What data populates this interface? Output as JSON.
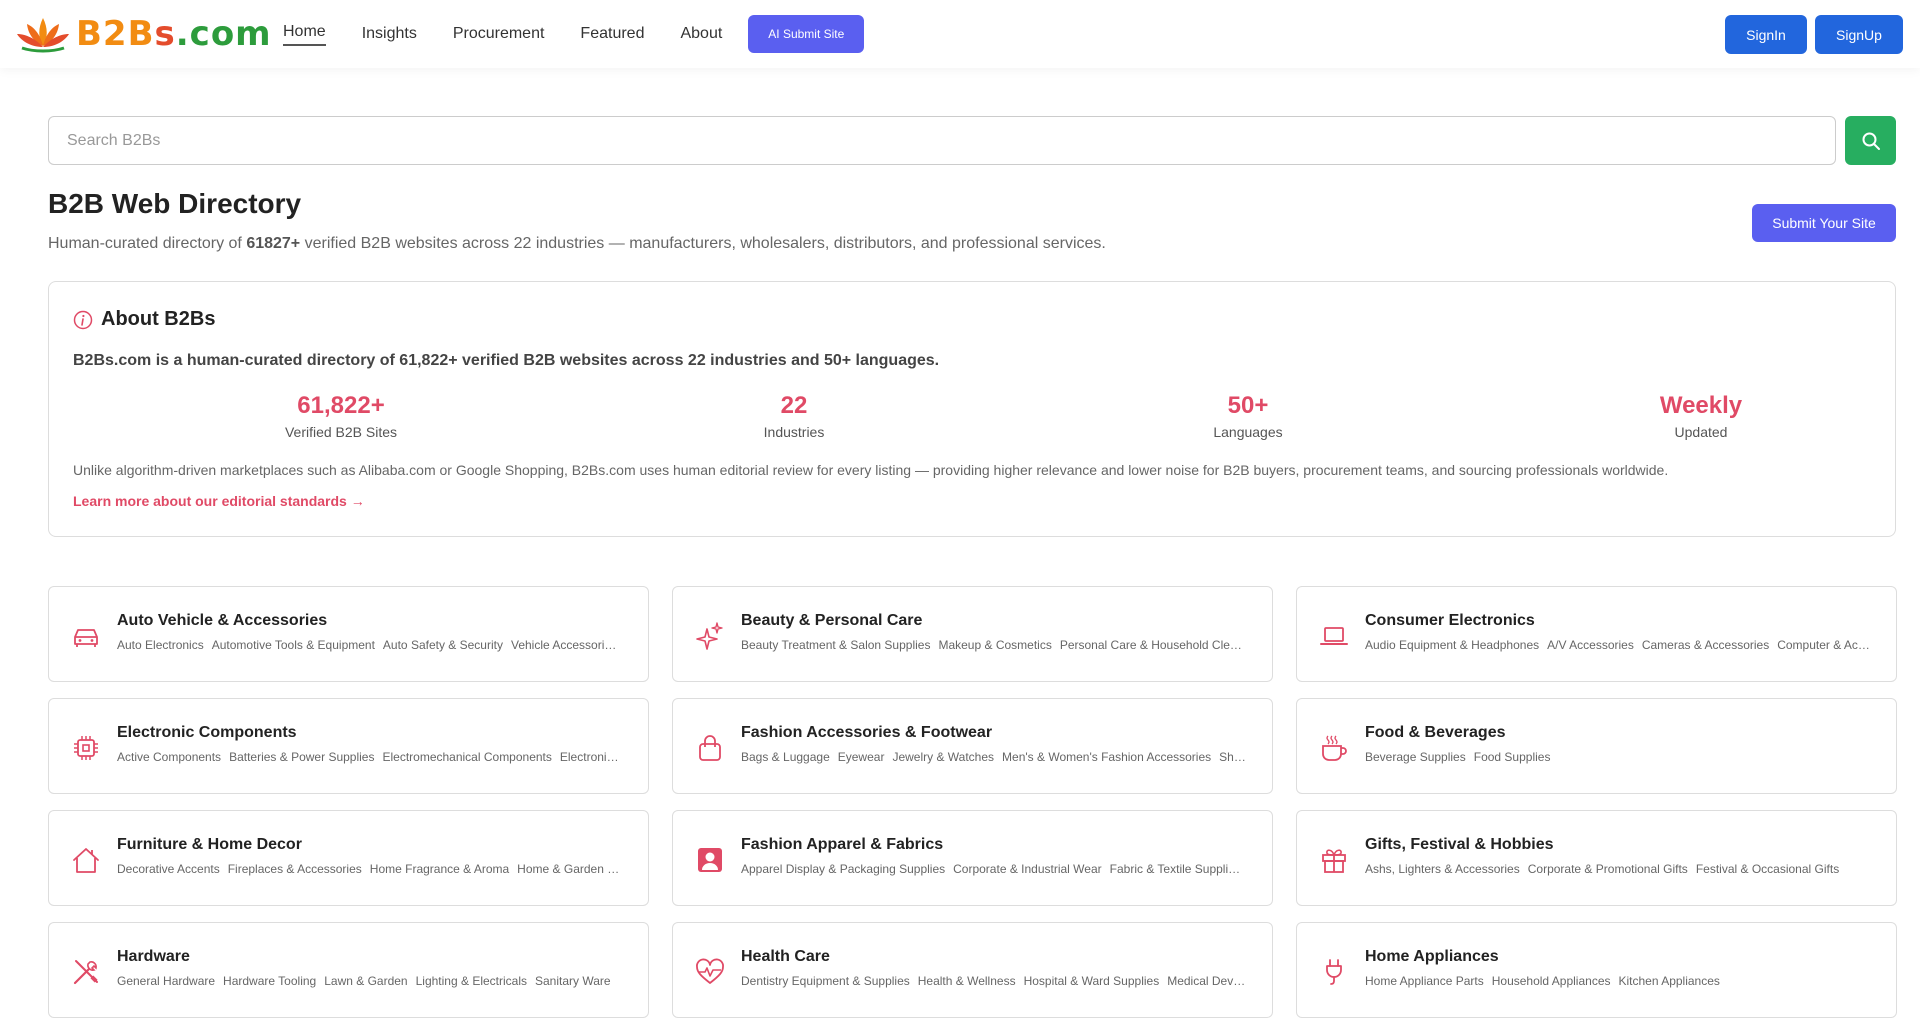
{
  "logo": {
    "b2b": "B2B",
    "s": "s",
    "com": ".com"
  },
  "nav": [
    {
      "label": "Home",
      "active": true
    },
    {
      "label": "Insights"
    },
    {
      "label": "Procurement"
    },
    {
      "label": "Featured"
    },
    {
      "label": "About"
    }
  ],
  "ai_submit": "AI Submit Site",
  "auth": {
    "signin": "SignIn",
    "signup": "SignUp"
  },
  "search": {
    "placeholder": "Search B2Bs"
  },
  "title": "B2B Web Directory",
  "subtitle": {
    "pre": "Human-curated directory of ",
    "count": "61827+",
    "post": " verified B2B websites across 22 industries — manufacturers, wholesalers, distributors, and professional services."
  },
  "submit_button": "Submit Your Site",
  "about": {
    "heading": "About B2Bs",
    "lead": "B2Bs.com is a human-curated directory of 61,822+ verified B2B websites across 22 industries and 50+ languages.",
    "stats": [
      {
        "value": "61,822+",
        "label": "Verified B2B Sites"
      },
      {
        "value": "22",
        "label": "Industries"
      },
      {
        "value": "50+",
        "label": "Languages"
      },
      {
        "value": "Weekly",
        "label": "Updated"
      }
    ],
    "body": "Unlike algorithm-driven marketplaces such as Alibaba.com or Google Shopping, B2Bs.com uses human editorial review for every listing — providing higher relevance and lower noise for B2B buyers, procurement teams, and sourcing professionals worldwide.",
    "link": "Learn more about our editorial standards →"
  },
  "colors": {
    "accent": "#e04a66",
    "primary": "#5a5ff0",
    "auth": "#2266dd",
    "search": "#27ae60"
  },
  "categories": [
    {
      "title": "Auto Vehicle & Accessories",
      "icon": "car-icon",
      "subs": [
        "Auto Electronics",
        "Automotive Tools & Equipment",
        "Auto Safety & Security",
        "Vehicle Accessories"
      ]
    },
    {
      "title": "Beauty & Personal Care",
      "icon": "sparkles-icon",
      "subs": [
        "Beauty Treatment & Salon Supplies",
        "Makeup & Cosmetics",
        "Personal Care & Household Cleaning"
      ]
    },
    {
      "title": "Consumer Electronics",
      "icon": "laptop-icon",
      "subs": [
        "Audio Equipment & Headphones",
        "A/V Accessories",
        "Cameras & Accessories",
        "Computer & Accessories"
      ]
    },
    {
      "title": "Electronic Components",
      "icon": "chip-icon",
      "subs": [
        "Active Components",
        "Batteries & Power Supplies",
        "Electromechanical Components",
        "Electronic Accessories"
      ]
    },
    {
      "title": "Fashion Accessories & Footwear",
      "icon": "bag-icon",
      "subs": [
        "Bags & Luggage",
        "Eyewear",
        "Jewelry & Watches",
        "Men's & Women's Fashion Accessories",
        "Shoes"
      ]
    },
    {
      "title": "Food & Beverages",
      "icon": "coffee-cup-icon",
      "subs": [
        "Beverage Supplies",
        "Food Supplies"
      ]
    },
    {
      "title": "Furniture & Home Decor",
      "icon": "house-icon",
      "subs": [
        "Decorative Accents",
        "Fireplaces & Accessories",
        "Home Fragrance & Aroma",
        "Home & Garden Furniture"
      ]
    },
    {
      "title": "Fashion Apparel & Fabrics",
      "icon": "person-badge-icon",
      "subs": [
        "Apparel Display & Packaging Supplies",
        "Corporate & Industrial Wear",
        "Fabric & Textile Supplies"
      ]
    },
    {
      "title": "Gifts, Festival & Hobbies",
      "icon": "gift-icon",
      "subs": [
        "Ashs, Lighters & Accessories",
        "Corporate & Promotional Gifts",
        "Festival & Occasional Gifts"
      ]
    },
    {
      "title": "Hardware",
      "icon": "tools-icon",
      "subs": [
        "General Hardware",
        "Hardware Tooling",
        "Lawn & Garden",
        "Lighting & Electricals",
        "Sanitary Ware"
      ]
    },
    {
      "title": "Health Care",
      "icon": "heart-pulse-icon",
      "subs": [
        "Dentistry Equipment & Supplies",
        "Health & Wellness",
        "Hospital & Ward Supplies",
        "Medical Devices"
      ]
    },
    {
      "title": "Home Appliances",
      "icon": "plug-icon",
      "subs": [
        "Home Appliance Parts",
        "Household Appliances",
        "Kitchen Appliances"
      ]
    }
  ]
}
